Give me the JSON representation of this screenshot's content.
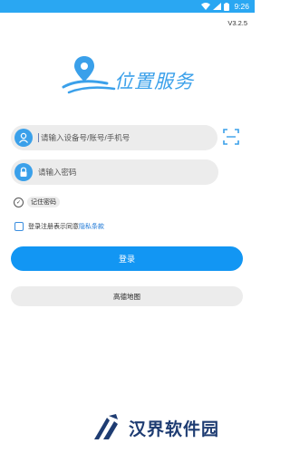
{
  "status_bar": {
    "time": "9:26",
    "icons": [
      "wifi-icon",
      "signal-icon",
      "battery-icon"
    ],
    "background": "#2aa7f2"
  },
  "version": "V3.2.5",
  "logo": {
    "text": "位置服务",
    "color": "#3aa0ea"
  },
  "account": {
    "placeholder": "请输入设备号/账号/手机号",
    "value": "",
    "icon": "user-icon"
  },
  "scan": {
    "icon": "scan-icon"
  },
  "password": {
    "placeholder": "请输入密码",
    "value": "",
    "icon": "lock-icon"
  },
  "remember": {
    "label": "记住密码",
    "checked": true
  },
  "agreement": {
    "text": "登录注册表示同意",
    "link": "隐私条款",
    "checked": false
  },
  "login_button": {
    "label": "登录",
    "color": "#1296f3"
  },
  "map_button": {
    "label": "高德地图"
  },
  "watermark": {
    "text": "汉界软件园"
  }
}
